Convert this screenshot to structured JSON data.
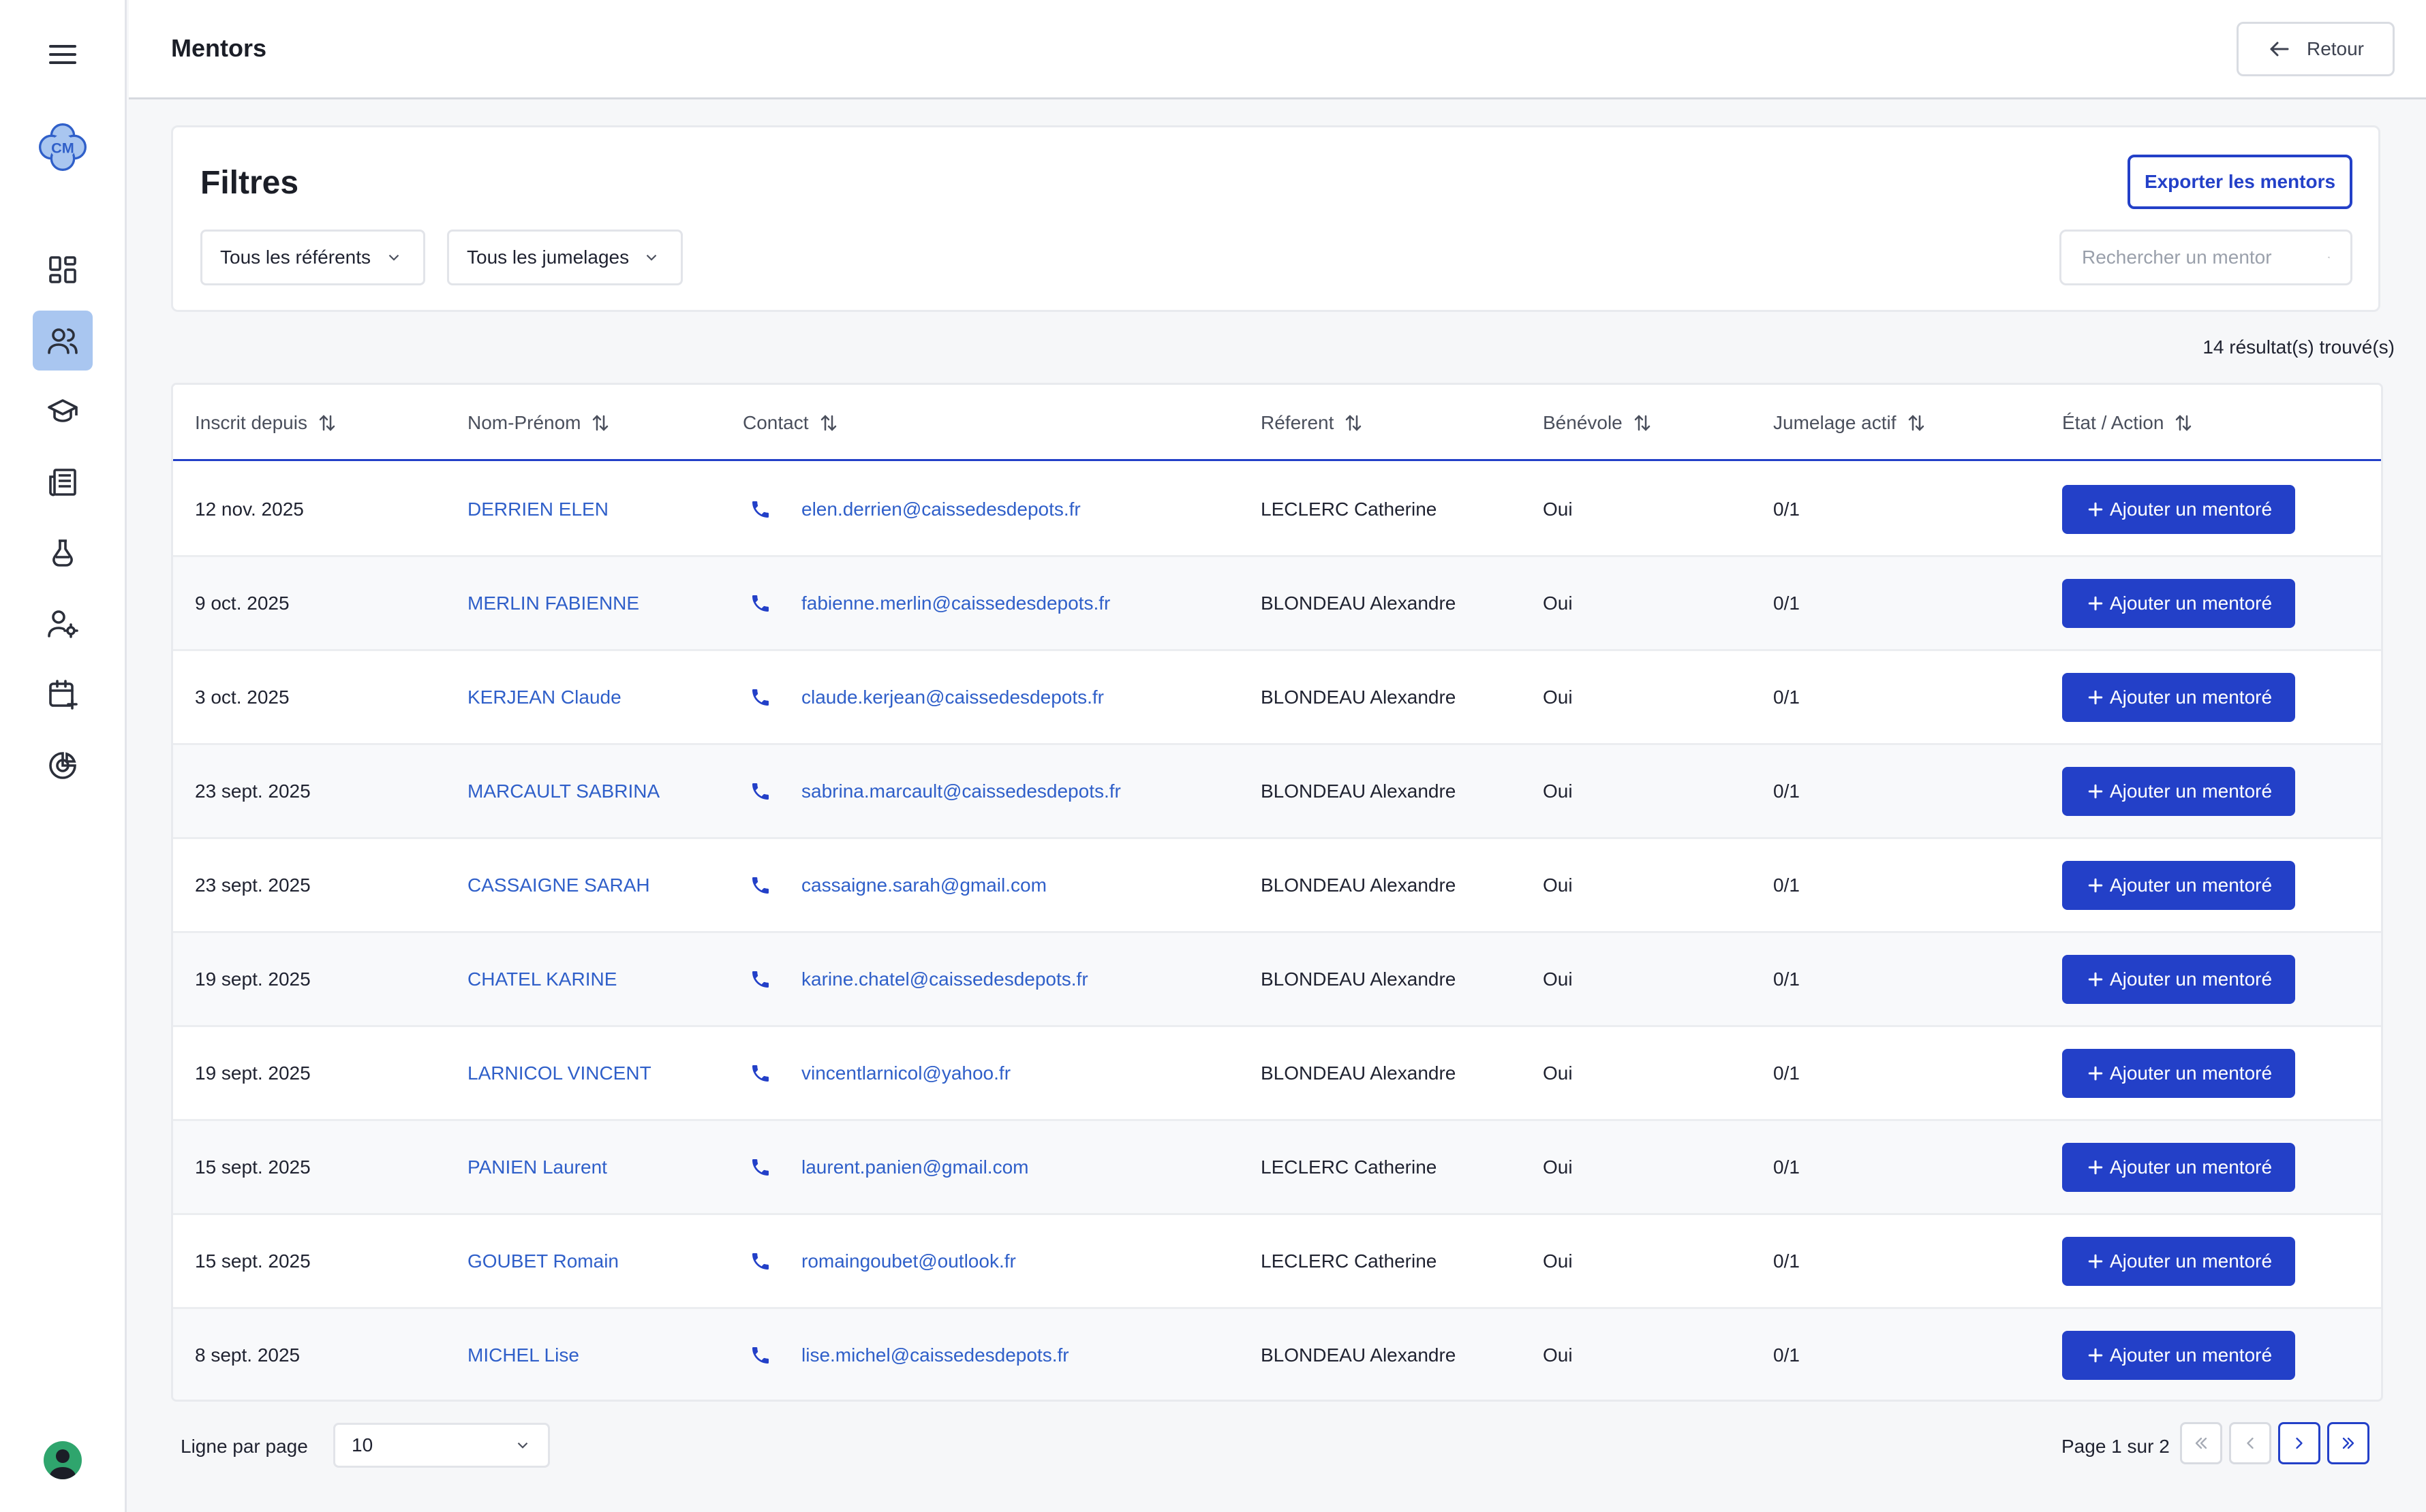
{
  "header": {
    "title": "Mentors",
    "back_label": "Retour"
  },
  "filters": {
    "title": "Filtres",
    "export_label": "Exporter les mentors",
    "referent_select": "Tous les référents",
    "jumelage_select": "Tous les jumelages",
    "search_placeholder": "Rechercher un mentor"
  },
  "results_count": "14 résultat(s) trouvé(s)",
  "table": {
    "columns": [
      "Inscrit depuis",
      "Nom-Prénom",
      "Contact",
      "Réferent",
      "Bénévole",
      "Jumelage actif",
      "État / Action"
    ],
    "action_label": "Ajouter un mentoré",
    "rows": [
      {
        "date": "12 nov. 2025",
        "name": "DERRIEN ELEN",
        "email": "elen.derrien@caissedesdepots.fr",
        "referent": "LECLERC Catherine",
        "benevole": "Oui",
        "jumelage": "0/1"
      },
      {
        "date": "9 oct. 2025",
        "name": "MERLIN FABIENNE",
        "email": "fabienne.merlin@caissedesdepots.fr",
        "referent": "BLONDEAU Alexandre",
        "benevole": "Oui",
        "jumelage": "0/1"
      },
      {
        "date": "3 oct. 2025",
        "name": "KERJEAN Claude",
        "email": "claude.kerjean@caissedesdepots.fr",
        "referent": "BLONDEAU Alexandre",
        "benevole": "Oui",
        "jumelage": "0/1"
      },
      {
        "date": "23 sept. 2025",
        "name": "MARCAULT SABRINA",
        "email": "sabrina.marcault@caissedesdepots.fr",
        "referent": "BLONDEAU Alexandre",
        "benevole": "Oui",
        "jumelage": "0/1"
      },
      {
        "date": "23 sept. 2025",
        "name": "CASSAIGNE SARAH",
        "email": "cassaigne.sarah@gmail.com",
        "referent": "BLONDEAU Alexandre",
        "benevole": "Oui",
        "jumelage": "0/1"
      },
      {
        "date": "19 sept. 2025",
        "name": "CHATEL KARINE",
        "email": "karine.chatel@caissedesdepots.fr",
        "referent": "BLONDEAU Alexandre",
        "benevole": "Oui",
        "jumelage": "0/1"
      },
      {
        "date": "19 sept. 2025",
        "name": "LARNICOL VINCENT",
        "email": "vincentlarnicol@yahoo.fr",
        "referent": "BLONDEAU Alexandre",
        "benevole": "Oui",
        "jumelage": "0/1"
      },
      {
        "date": "15 sept. 2025",
        "name": "PANIEN Laurent",
        "email": "laurent.panien@gmail.com",
        "referent": "LECLERC Catherine",
        "benevole": "Oui",
        "jumelage": "0/1"
      },
      {
        "date": "15 sept. 2025",
        "name": "GOUBET Romain",
        "email": "romaingoubet@outlook.fr",
        "referent": "LECLERC Catherine",
        "benevole": "Oui",
        "jumelage": "0/1"
      },
      {
        "date": "8 sept. 2025",
        "name": "MICHEL Lise",
        "email": "lise.michel@caissedesdepots.fr",
        "referent": "BLONDEAU Alexandre",
        "benevole": "Oui",
        "jumelage": "0/1"
      }
    ]
  },
  "pagination": {
    "rows_per_page_label": "Ligne par page",
    "rows_per_page_value": "10",
    "page_info": "Page 1 sur 2"
  },
  "sidebar": {
    "logo_text": "CM",
    "items": [
      "menu-icon",
      "dashboard-icon",
      "users-icon",
      "graduation-cap-icon",
      "newspaper-icon",
      "flask-icon",
      "user-cog-icon",
      "calendar-plus-icon",
      "chart-icon"
    ]
  },
  "colors": {
    "primary": "#2340c8",
    "link": "#2f5fc9",
    "sidebar_active": "#a9c6f0"
  }
}
